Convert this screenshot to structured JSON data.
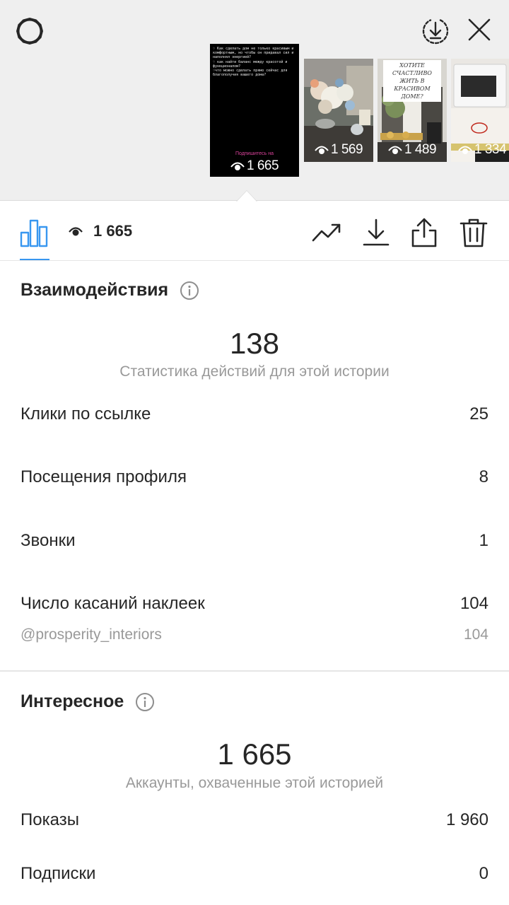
{
  "thumbnails": [
    {
      "story_text": "♡ Как сделать дом не только красивым и комфортным, но чтобы он придавал сил и наполнял энергией?\n♡ как найти баланс между красотой и функционалом?\n♡что можно сделать прямо сейчас для благополучия вашего дома?",
      "subscribe_text": "Подпишитесь на",
      "views": "1 665"
    },
    {
      "views": "1 569"
    },
    {
      "overlay_text": "ХОТИТЕ СЧАСТЛИВО ЖИТЬ В КРАСИВОМ ДОМЕ?",
      "views": "1 489"
    },
    {
      "views": "1 334"
    }
  ],
  "toolbar": {
    "views_count": "1 665"
  },
  "interactions": {
    "title": "Взаимодействия",
    "total": "138",
    "caption": "Статистика действий для этой истории",
    "rows": [
      {
        "label": "Клики по ссылке",
        "value": "25"
      },
      {
        "label": "Посещения профиля",
        "value": "8"
      },
      {
        "label": "Звонки",
        "value": "1"
      },
      {
        "label": "Число касаний наклеек",
        "value": "104"
      }
    ],
    "sticker": {
      "label": "@prosperity_interiors",
      "value": "104"
    }
  },
  "discovery": {
    "title": "Интересное",
    "total": "1 665",
    "caption": "Аккаунты, охваченные этой историей",
    "rows": [
      {
        "label": "Показы",
        "value": "1 960"
      },
      {
        "label": "Подписки",
        "value": "0"
      }
    ]
  },
  "colors": {
    "accent": "#3897f0",
    "text": "#262626",
    "secondary": "#999999"
  },
  "icons": {
    "settings": "settings-gear-icon",
    "download": "download-circle-icon",
    "close": "close-icon",
    "insights": "bar-chart-icon",
    "views": "eye-icon",
    "trend": "trend-up-icon",
    "save": "download-icon",
    "share": "share-icon",
    "delete": "trash-icon",
    "info": "info-icon"
  }
}
